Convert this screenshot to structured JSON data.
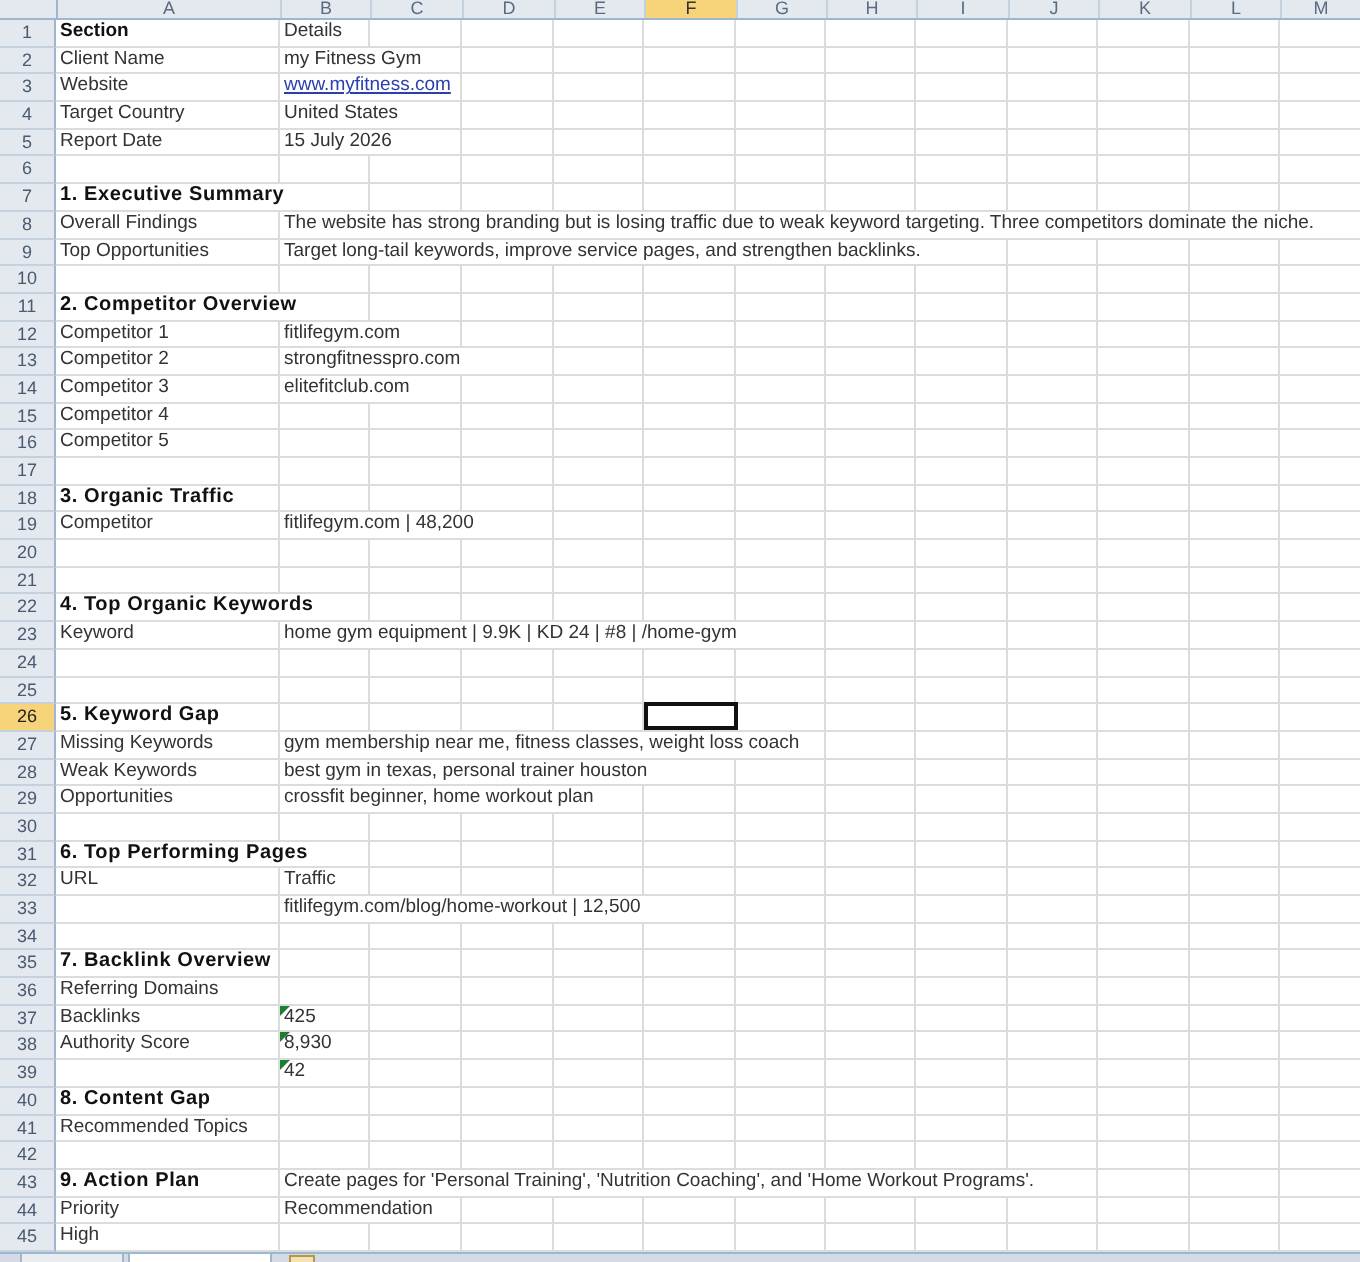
{
  "columns": [
    {
      "label": "A",
      "selected": false
    },
    {
      "label": "B",
      "selected": false
    },
    {
      "label": "C",
      "selected": false
    },
    {
      "label": "D",
      "selected": false
    },
    {
      "label": "E",
      "selected": false
    },
    {
      "label": "F",
      "selected": true
    },
    {
      "label": "G",
      "selected": false
    },
    {
      "label": "H",
      "selected": false
    },
    {
      "label": "I",
      "selected": false
    },
    {
      "label": "J",
      "selected": false
    },
    {
      "label": "K",
      "selected": false
    },
    {
      "label": "L",
      "selected": false
    },
    {
      "label": "M",
      "selected": false
    }
  ],
  "rows": [
    {
      "num": "1",
      "selected": false,
      "kind": "header",
      "a": "Section",
      "b": "Details"
    },
    {
      "num": "2",
      "selected": false,
      "kind": "normal",
      "a": "Client Name",
      "b": "my Fitness Gym"
    },
    {
      "num": "3",
      "selected": false,
      "kind": "normal",
      "a": "Website",
      "b": "www.myfitness.com",
      "link": true
    },
    {
      "num": "4",
      "selected": false,
      "kind": "normal",
      "a": "Target Country",
      "b": "United States"
    },
    {
      "num": "5",
      "selected": false,
      "kind": "normal",
      "a": "Report Date",
      "b": "15 July 2026"
    },
    {
      "num": "6",
      "selected": false
    },
    {
      "num": "7",
      "selected": false,
      "kind": "section",
      "a": "1. Executive Summary"
    },
    {
      "num": "8",
      "selected": false,
      "kind": "normal",
      "a": "Overall Findings",
      "b": "The website has strong branding but is losing traffic due to weak keyword targeting. Three competitors dominate the niche."
    },
    {
      "num": "9",
      "selected": false,
      "kind": "normal",
      "a": "Top Opportunities",
      "b": "Target long-tail keywords, improve service pages, and strengthen backlinks."
    },
    {
      "num": "10",
      "selected": false
    },
    {
      "num": "11",
      "selected": false,
      "kind": "section",
      "a": "2. Competitor Overview"
    },
    {
      "num": "12",
      "selected": false,
      "kind": "normal",
      "a": "Competitor 1",
      "b": "fitlifegym.com"
    },
    {
      "num": "13",
      "selected": false,
      "kind": "normal",
      "a": "Competitor 2",
      "b": "strongfitnesspro.com"
    },
    {
      "num": "14",
      "selected": false,
      "kind": "normal",
      "a": "Competitor 3",
      "b": "elitefitclub.com"
    },
    {
      "num": "15",
      "selected": false,
      "kind": "normal",
      "a": "Competitor 4"
    },
    {
      "num": "16",
      "selected": false,
      "kind": "normal",
      "a": "Competitor 5"
    },
    {
      "num": "17",
      "selected": false
    },
    {
      "num": "18",
      "selected": false,
      "kind": "section",
      "a": "3. Organic Traffic"
    },
    {
      "num": "19",
      "selected": false,
      "kind": "normal",
      "a": "Competitor",
      "b": "fitlifegym.com | 48,200"
    },
    {
      "num": "20",
      "selected": false
    },
    {
      "num": "21",
      "selected": false
    },
    {
      "num": "22",
      "selected": false,
      "kind": "section",
      "a": "4. Top Organic Keywords"
    },
    {
      "num": "23",
      "selected": false,
      "kind": "normal",
      "a": "Keyword",
      "b": "home gym equipment | 9.9K | KD 24 | #8 | /home-gym"
    },
    {
      "num": "24",
      "selected": false
    },
    {
      "num": "25",
      "selected": false
    },
    {
      "num": "26",
      "selected": true,
      "kind": "section",
      "a": "5. Keyword Gap"
    },
    {
      "num": "27",
      "selected": false,
      "kind": "normal",
      "a": "Missing Keywords",
      "b": "gym membership near me, fitness classes, weight loss coach"
    },
    {
      "num": "28",
      "selected": false,
      "kind": "normal",
      "a": "Weak Keywords",
      "b": "best gym in texas, personal trainer houston"
    },
    {
      "num": "29",
      "selected": false,
      "kind": "normal",
      "a": "Opportunities",
      "b": "crossfit beginner, home workout plan"
    },
    {
      "num": "30",
      "selected": false
    },
    {
      "num": "31",
      "selected": false,
      "kind": "section",
      "a": "6. Top Performing Pages"
    },
    {
      "num": "32",
      "selected": false,
      "kind": "normal",
      "a": "URL",
      "b": "Traffic"
    },
    {
      "num": "33",
      "selected": false,
      "b": "fitlifegym.com/blog/home-workout | 12,500"
    },
    {
      "num": "34",
      "selected": false
    },
    {
      "num": "35",
      "selected": false,
      "kind": "section",
      "a": "7. Backlink Overview"
    },
    {
      "num": "36",
      "selected": false,
      "kind": "normal",
      "a": "Referring Domains"
    },
    {
      "num": "37",
      "selected": false,
      "kind": "normal",
      "a": "Backlinks",
      "b": "425",
      "flag": true
    },
    {
      "num": "38",
      "selected": false,
      "kind": "normal",
      "a": "Authority Score",
      "b": "8,930",
      "flag": true
    },
    {
      "num": "39",
      "selected": false,
      "b": "42",
      "flag": true
    },
    {
      "num": "40",
      "selected": false,
      "kind": "section",
      "a": "8. Content Gap"
    },
    {
      "num": "41",
      "selected": false,
      "kind": "normal",
      "a": "Recommended Topics"
    },
    {
      "num": "42",
      "selected": false
    },
    {
      "num": "43",
      "selected": false,
      "kind": "section",
      "a": "9. Action Plan",
      "b": "Create pages for 'Personal Training', 'Nutrition Coaching', and 'Home Workout Programs'."
    },
    {
      "num": "44",
      "selected": false,
      "kind": "normal",
      "a": "Priority",
      "b": "Recommendation"
    },
    {
      "num": "45",
      "selected": false,
      "kind": "normal",
      "a": "High"
    }
  ]
}
